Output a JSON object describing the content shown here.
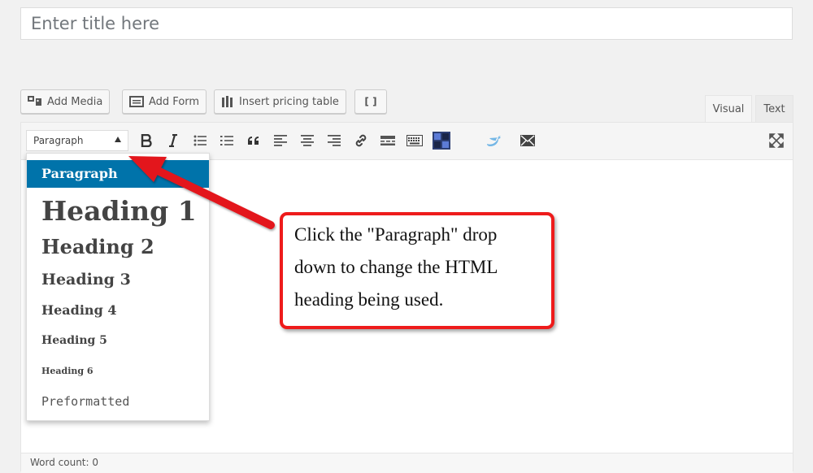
{
  "title_field": {
    "placeholder": "Enter title here"
  },
  "media_buttons": [
    {
      "label": "Add Media",
      "icon": "media-icon"
    },
    {
      "label": "Add Form",
      "icon": "form-icon"
    },
    {
      "label": "Insert pricing table",
      "icon": "pricing-table-icon"
    },
    {
      "label": "[ ]",
      "icon": "shortcode-icon"
    }
  ],
  "editor_tabs": {
    "visual": "Visual",
    "text": "Text"
  },
  "toolbar": {
    "format_select": "Paragraph",
    "buttons": [
      "bold-icon",
      "italic-icon",
      "bulleted-list-icon",
      "numbered-list-icon",
      "blockquote-icon",
      "align-left-icon",
      "align-center-icon",
      "align-right-icon",
      "link-icon",
      "read-more-icon",
      "toolbar-toggle-icon",
      "pricing-block-icon",
      "twitter-icon",
      "email-icon",
      "fullscreen-icon"
    ]
  },
  "format_dropdown": {
    "items": [
      "Paragraph",
      "Heading 1",
      "Heading 2",
      "Heading 3",
      "Heading 4",
      "Heading 5",
      "Heading 6",
      "Preformatted"
    ],
    "selected": "Paragraph"
  },
  "callout": {
    "text": "Click the \"Paragraph\" drop\ndown to change the HTML\nheading being used."
  },
  "status_bar": {
    "word_count": "Word count: 0"
  },
  "colors": {
    "selected": "#0073aa",
    "callout_border": "#ee1b1b",
    "arrow": "#e3141b"
  }
}
